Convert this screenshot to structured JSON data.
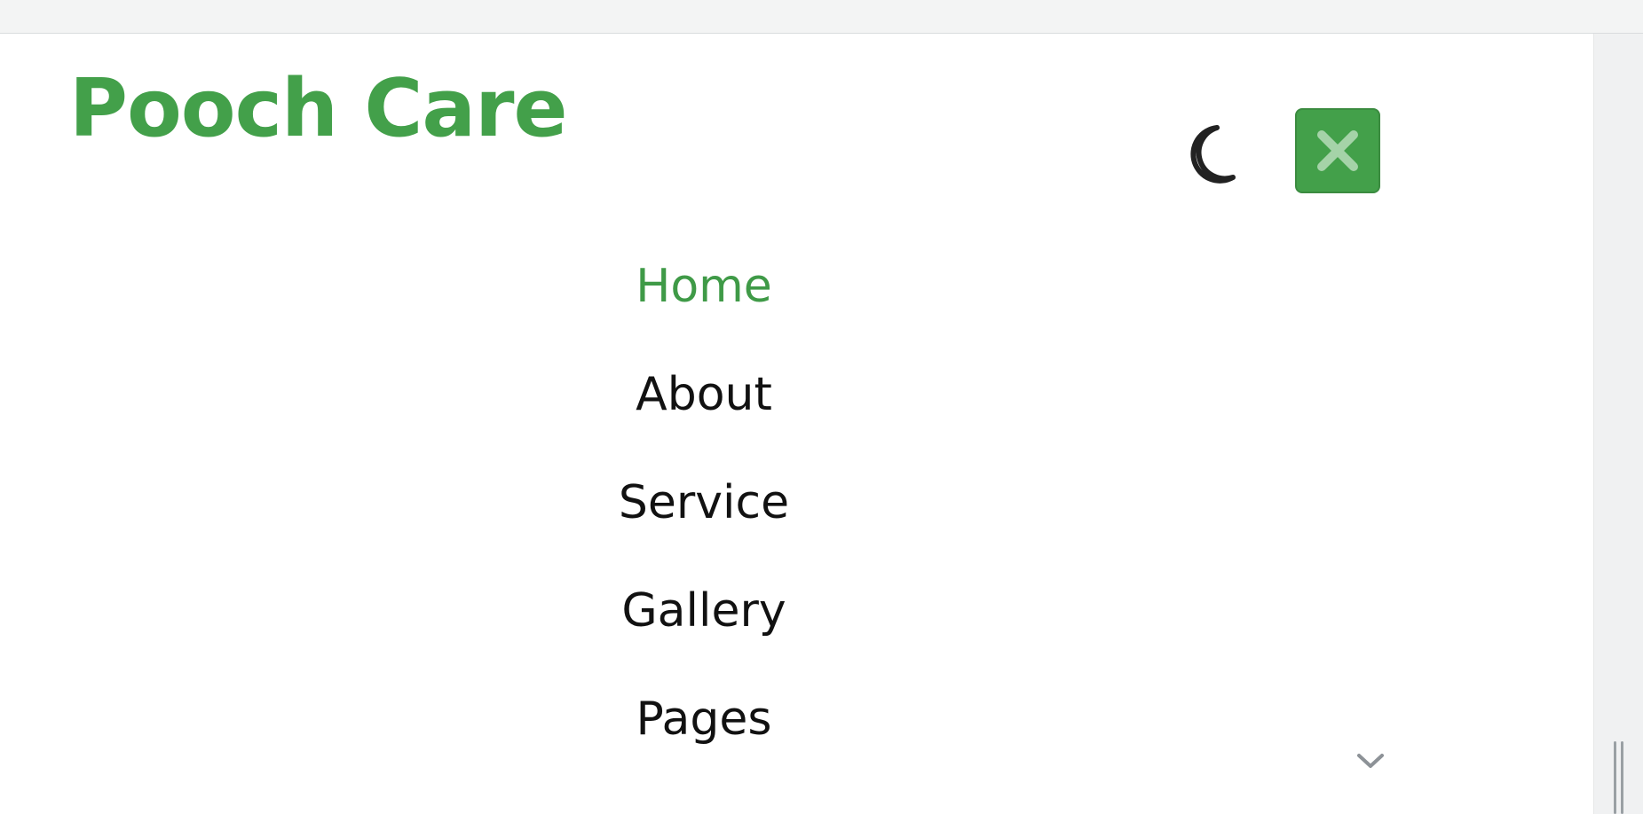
{
  "header": {
    "brand": "Pooch Care",
    "theme_toggle_icon": "moon-icon",
    "close_icon": "close-icon"
  },
  "nav": {
    "items": [
      {
        "label": "Home",
        "active": true
      },
      {
        "label": "About",
        "active": false
      },
      {
        "label": "Service",
        "active": false
      },
      {
        "label": "Gallery",
        "active": false
      },
      {
        "label": "Pages",
        "active": false
      }
    ],
    "pages_dropdown_icon": "chevron-down-icon"
  },
  "colors": {
    "brand_green": "#43a04a",
    "close_button_bg": "#43a04a",
    "close_icon": "#a5d3a8",
    "active_nav": "#3f9a47",
    "moon_icon": "#222222",
    "chevron": "#8d9297"
  }
}
